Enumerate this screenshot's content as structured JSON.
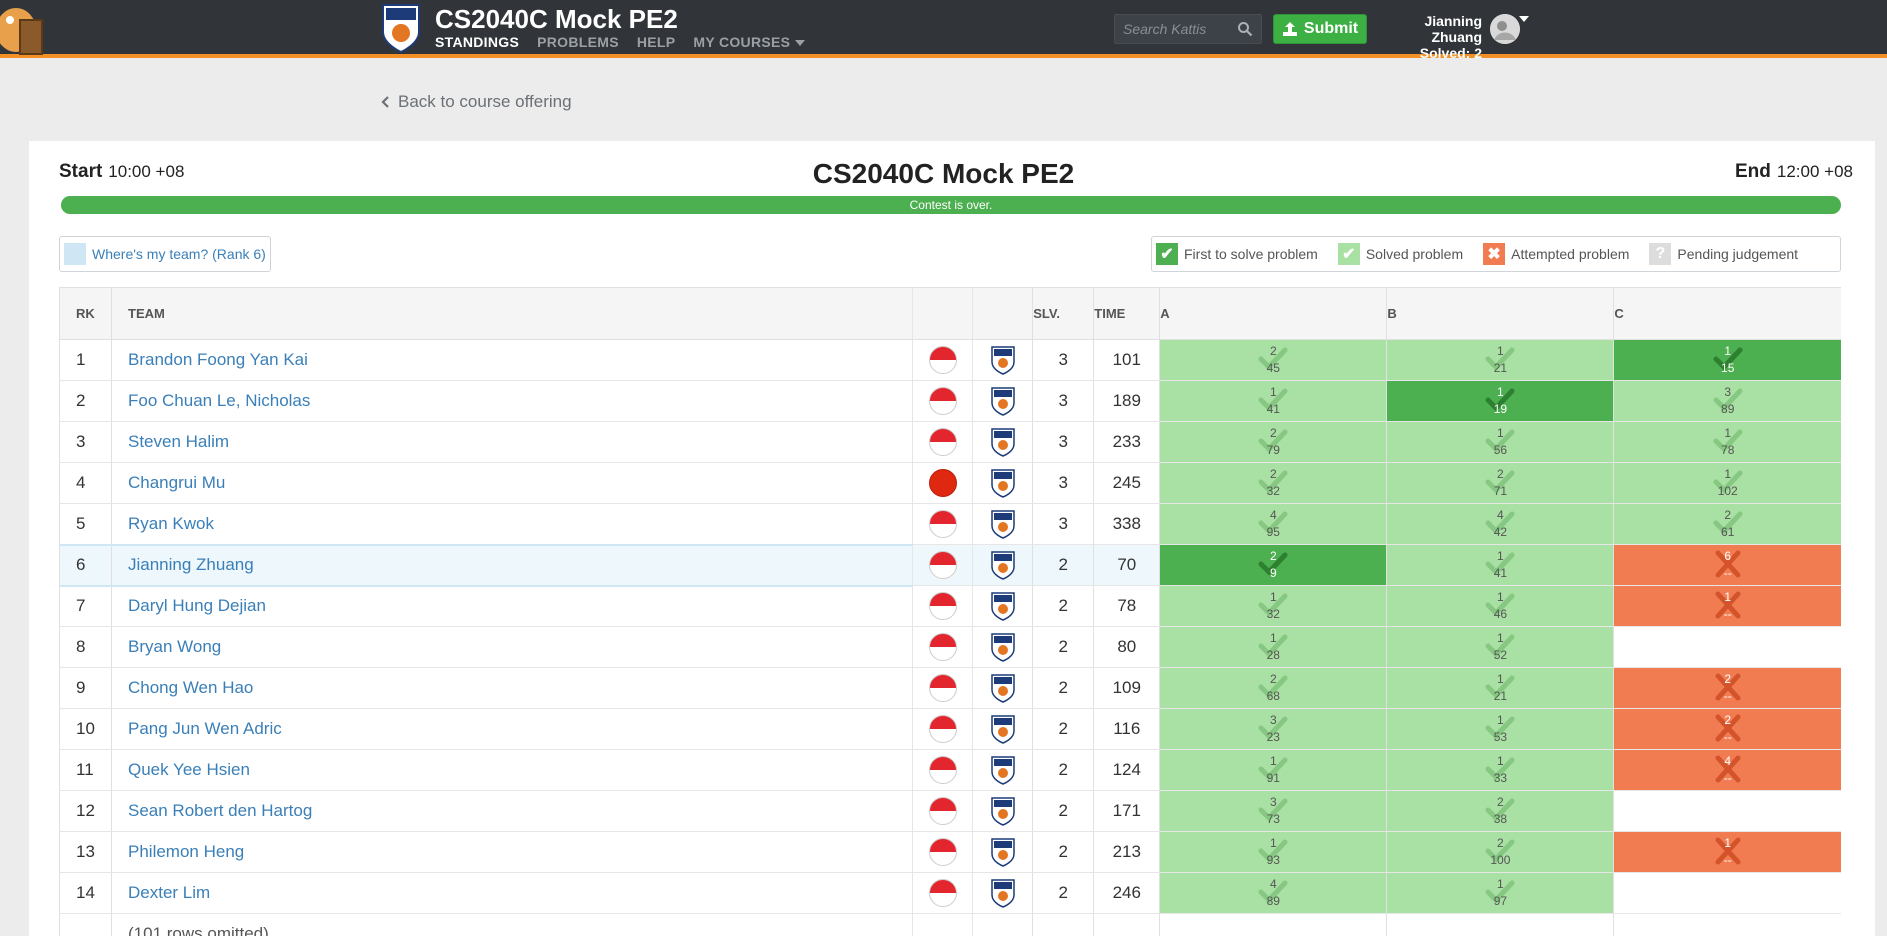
{
  "header": {
    "course_title": "CS2040C Mock PE2",
    "nav": [
      {
        "label": "STANDINGS",
        "active": true
      },
      {
        "label": "PROBLEMS",
        "active": false
      },
      {
        "label": "HELP",
        "active": false
      },
      {
        "label": "MY COURSES",
        "active": false
      }
    ],
    "search_placeholder": "Search Kattis",
    "submit_label": "Submit",
    "user_name": "Jianning Zhuang",
    "user_solved": "Solved: 2",
    "accent_color": "#f29025"
  },
  "back_link": "Back to course offering",
  "contest": {
    "start_label": "Start",
    "start_time": "10:00 +08",
    "title": "CS2040C Mock PE2",
    "end_label": "End",
    "end_time": "12:00 +08",
    "status": "Contest is over.",
    "progress": 1.0
  },
  "my_team_button": "Where's my team? (Rank 6)",
  "legend": {
    "first": "First to solve problem",
    "solved": "Solved problem",
    "attempted": "Attempted problem",
    "pending": "Pending judgement",
    "colors": {
      "first": "#4caf50",
      "solved": "#a9e0a3",
      "attempted": "#f27c51",
      "pending": "#dddddd"
    }
  },
  "table": {
    "headers": {
      "rk": "RK",
      "team": "TEAM",
      "slv": "SLV.",
      "time": "TIME",
      "problems": [
        "A",
        "B",
        "C"
      ]
    },
    "rows": [
      {
        "rk": "1",
        "team": "Brandon Foong Yan Kai",
        "flag": "sg",
        "slv": "3",
        "time": "101",
        "cells": [
          {
            "s": "solved",
            "t": "2",
            "m": "45"
          },
          {
            "s": "solved",
            "t": "1",
            "m": "21"
          },
          {
            "s": "first",
            "t": "1",
            "m": "15"
          }
        ]
      },
      {
        "rk": "2",
        "team": "Foo Chuan Le, Nicholas",
        "flag": "sg",
        "slv": "3",
        "time": "189",
        "cells": [
          {
            "s": "solved",
            "t": "1",
            "m": "41"
          },
          {
            "s": "first",
            "t": "1",
            "m": "19"
          },
          {
            "s": "solved",
            "t": "3",
            "m": "89"
          }
        ]
      },
      {
        "rk": "3",
        "team": "Steven Halim",
        "flag": "sg",
        "slv": "3",
        "time": "233",
        "cells": [
          {
            "s": "solved",
            "t": "2",
            "m": "79"
          },
          {
            "s": "solved",
            "t": "1",
            "m": "56"
          },
          {
            "s": "solved",
            "t": "1",
            "m": "78"
          }
        ]
      },
      {
        "rk": "4",
        "team": "Changrui Mu",
        "flag": "cn",
        "slv": "3",
        "time": "245",
        "cells": [
          {
            "s": "solved",
            "t": "2",
            "m": "32"
          },
          {
            "s": "solved",
            "t": "2",
            "m": "71"
          },
          {
            "s": "solved",
            "t": "1",
            "m": "102"
          }
        ]
      },
      {
        "rk": "5",
        "team": "Ryan Kwok",
        "flag": "sg",
        "slv": "3",
        "time": "338",
        "cells": [
          {
            "s": "solved",
            "t": "4",
            "m": "95"
          },
          {
            "s": "solved",
            "t": "4",
            "m": "42"
          },
          {
            "s": "solved",
            "t": "2",
            "m": "61"
          }
        ]
      },
      {
        "rk": "6",
        "team": "Jianning Zhuang",
        "flag": "sg",
        "slv": "2",
        "time": "70",
        "me": true,
        "cells": [
          {
            "s": "first",
            "t": "2",
            "m": "9"
          },
          {
            "s": "solved",
            "t": "1",
            "m": "41"
          },
          {
            "s": "attempted",
            "t": "6",
            "m": "--"
          }
        ]
      },
      {
        "rk": "7",
        "team": "Daryl Hung Dejian",
        "flag": "sg",
        "slv": "2",
        "time": "78",
        "cells": [
          {
            "s": "solved",
            "t": "1",
            "m": "32"
          },
          {
            "s": "solved",
            "t": "1",
            "m": "46"
          },
          {
            "s": "attempted",
            "t": "1",
            "m": "--"
          }
        ]
      },
      {
        "rk": "8",
        "team": "Bryan Wong",
        "flag": "sg",
        "slv": "2",
        "time": "80",
        "cells": [
          {
            "s": "solved",
            "t": "1",
            "m": "28"
          },
          {
            "s": "solved",
            "t": "1",
            "m": "52"
          },
          {
            "s": "empty",
            "t": "",
            "m": ""
          }
        ]
      },
      {
        "rk": "9",
        "team": "Chong Wen Hao",
        "flag": "sg",
        "slv": "2",
        "time": "109",
        "cells": [
          {
            "s": "solved",
            "t": "2",
            "m": "68"
          },
          {
            "s": "solved",
            "t": "1",
            "m": "21"
          },
          {
            "s": "attempted",
            "t": "2",
            "m": "--"
          }
        ]
      },
      {
        "rk": "10",
        "team": "Pang Jun Wen Adric",
        "flag": "sg",
        "slv": "2",
        "time": "116",
        "cells": [
          {
            "s": "solved",
            "t": "3",
            "m": "23"
          },
          {
            "s": "solved",
            "t": "1",
            "m": "53"
          },
          {
            "s": "attempted",
            "t": "2",
            "m": "--"
          }
        ]
      },
      {
        "rk": "11",
        "team": "Quek Yee Hsien",
        "flag": "sg",
        "slv": "2",
        "time": "124",
        "cells": [
          {
            "s": "solved",
            "t": "1",
            "m": "91"
          },
          {
            "s": "solved",
            "t": "1",
            "m": "33"
          },
          {
            "s": "attempted",
            "t": "4",
            "m": "--"
          }
        ]
      },
      {
        "rk": "12",
        "team": "Sean Robert den Hartog",
        "flag": "sg",
        "slv": "2",
        "time": "171",
        "cells": [
          {
            "s": "solved",
            "t": "3",
            "m": "73"
          },
          {
            "s": "solved",
            "t": "2",
            "m": "38"
          },
          {
            "s": "empty",
            "t": "",
            "m": ""
          }
        ]
      },
      {
        "rk": "13",
        "team": "Philemon Heng",
        "flag": "sg",
        "slv": "2",
        "time": "213",
        "cells": [
          {
            "s": "solved",
            "t": "1",
            "m": "93"
          },
          {
            "s": "solved",
            "t": "2",
            "m": "100"
          },
          {
            "s": "attempted",
            "t": "1",
            "m": "--"
          }
        ]
      },
      {
        "rk": "14",
        "team": "Dexter Lim",
        "flag": "sg",
        "slv": "2",
        "time": "246",
        "cells": [
          {
            "s": "solved",
            "t": "4",
            "m": "89"
          },
          {
            "s": "solved",
            "t": "1",
            "m": "97"
          },
          {
            "s": "empty",
            "t": "",
            "m": ""
          }
        ]
      }
    ],
    "omitted_rk": "...",
    "omitted_text": "(101 rows omitted)"
  }
}
